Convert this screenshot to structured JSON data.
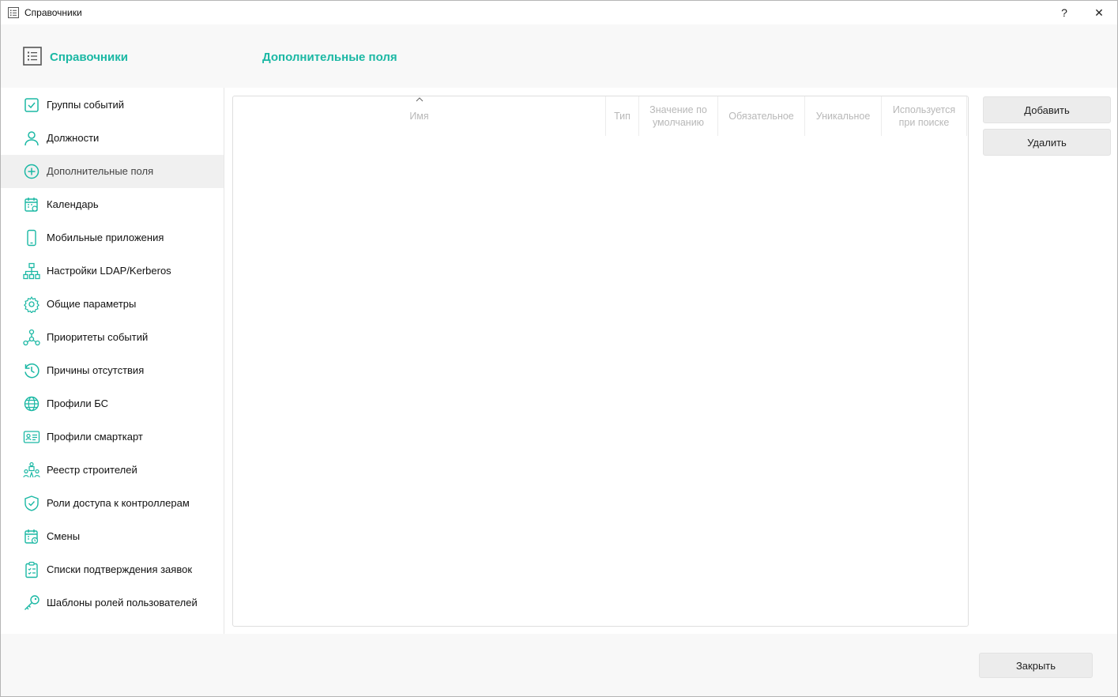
{
  "window": {
    "title": "Справочники",
    "help_label": "?",
    "close_label": "✕"
  },
  "header": {
    "title": "Справочники",
    "section": "Дополнительные поля"
  },
  "colors": {
    "accent": "#1bb8a4",
    "active_bg": "#f0f0f0"
  },
  "sidebar": {
    "items": [
      {
        "label": "Группы событий",
        "icon": "checkbox-icon"
      },
      {
        "label": "Должности",
        "icon": "person-icon"
      },
      {
        "label": "Дополнительные поля",
        "icon": "plus-circle-icon",
        "active": true
      },
      {
        "label": "Календарь",
        "icon": "calendar-icon"
      },
      {
        "label": "Мобильные приложения",
        "icon": "phone-icon"
      },
      {
        "label": "Настройки LDAP/Kerberos",
        "icon": "hierarchy-icon"
      },
      {
        "label": "Общие параметры",
        "icon": "gear-icon"
      },
      {
        "label": "Приоритеты событий",
        "icon": "nodes-icon"
      },
      {
        "label": "Причины отсутствия",
        "icon": "history-icon"
      },
      {
        "label": "Профили БС",
        "icon": "globe-icon"
      },
      {
        "label": "Профили смарткарт",
        "icon": "id-card-icon"
      },
      {
        "label": "Реестр строителей",
        "icon": "builders-icon"
      },
      {
        "label": "Роли доступа к контроллерам",
        "icon": "shield-icon"
      },
      {
        "label": "Смены",
        "icon": "calendar-clock-icon"
      },
      {
        "label": "Списки подтверждения заявок",
        "icon": "clipboard-icon"
      },
      {
        "label": "Шаблоны ролей пользователей",
        "icon": "key-icon"
      }
    ]
  },
  "table": {
    "columns": [
      {
        "label": "Имя",
        "sorted": "asc"
      },
      {
        "label": "Тип"
      },
      {
        "label": "Значение по умолчанию"
      },
      {
        "label": "Обязательное"
      },
      {
        "label": "Уникальное"
      },
      {
        "label": "Используется при поиске"
      }
    ],
    "rows": []
  },
  "actions": {
    "add_label": "Добавить",
    "delete_label": "Удалить",
    "close_label": "Закрыть"
  }
}
